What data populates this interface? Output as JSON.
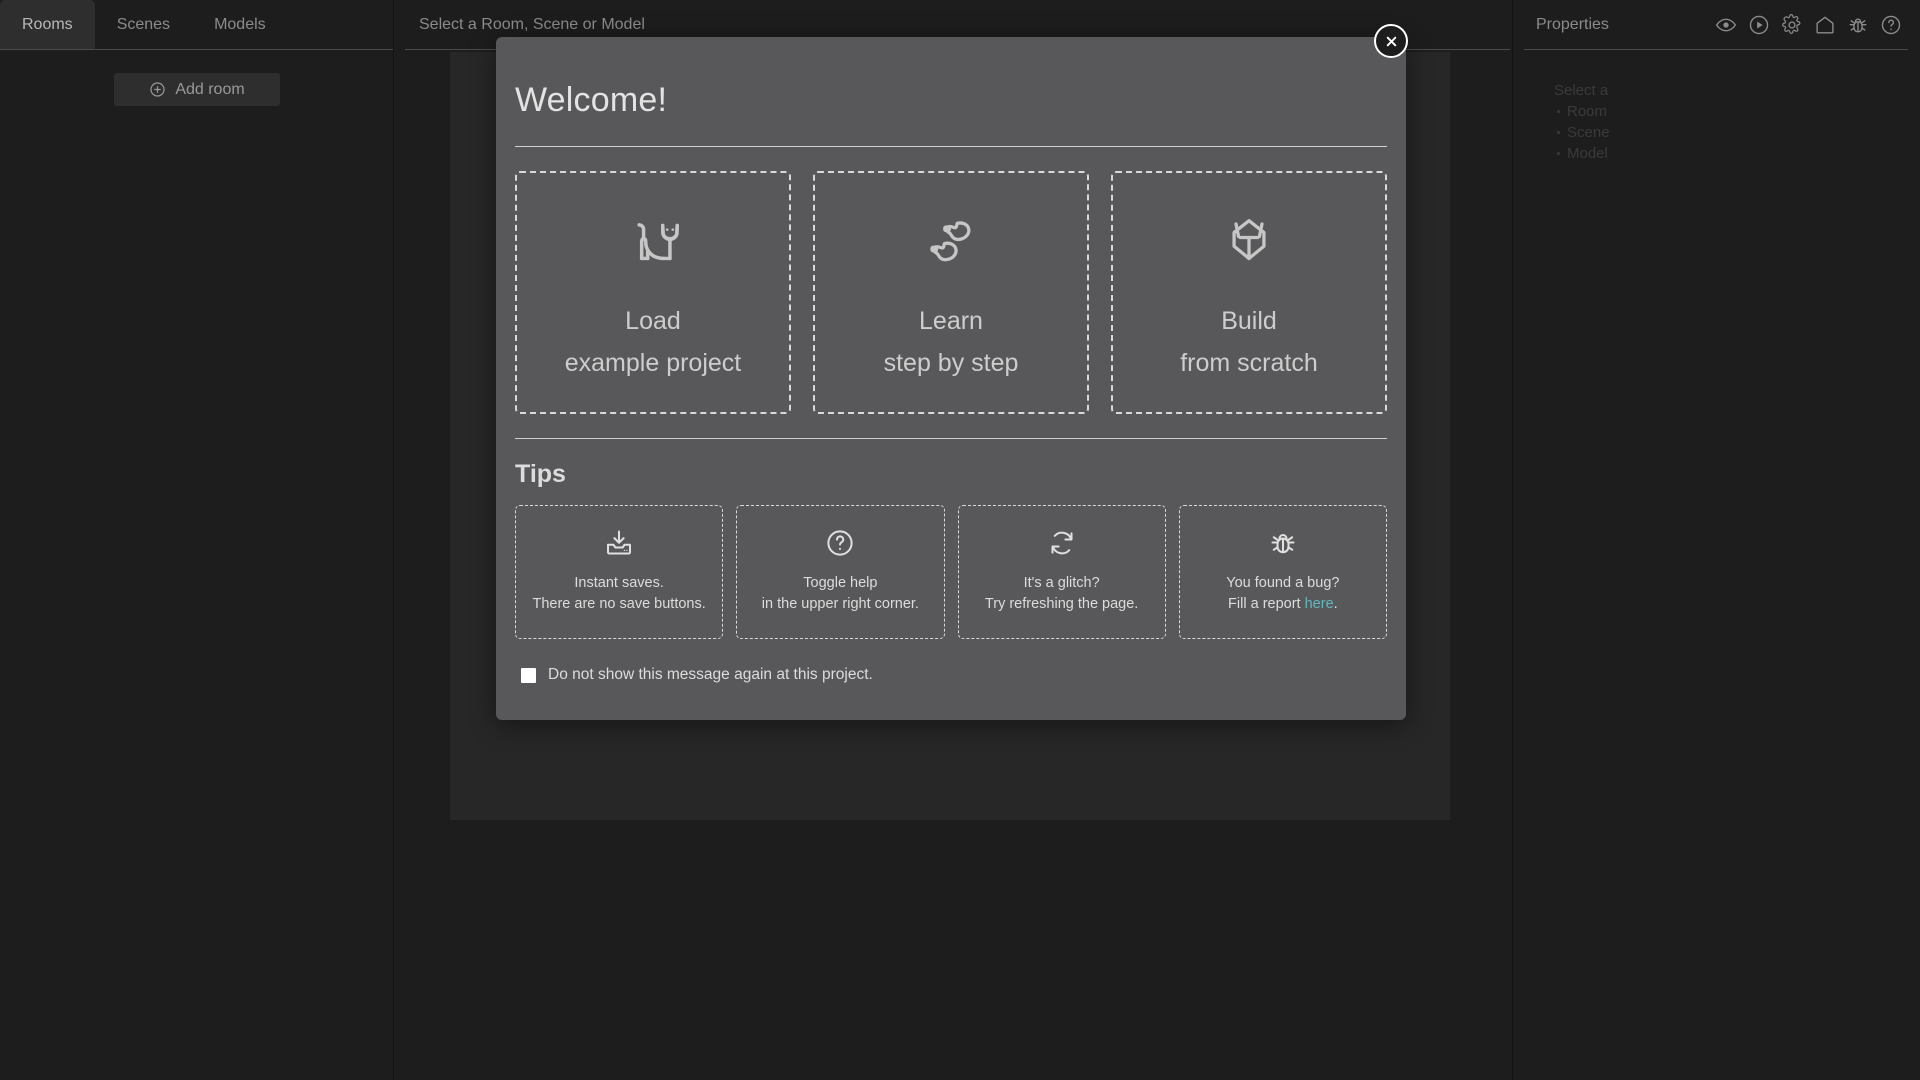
{
  "sidebar": {
    "tabs": [
      {
        "label": "Rooms",
        "active": true
      },
      {
        "label": "Scenes",
        "active": false
      },
      {
        "label": "Models",
        "active": false
      }
    ],
    "add_room_label": "Add room",
    "add_room_icon": "plus-circle-icon"
  },
  "center": {
    "title": "Select a Room, Scene or Model"
  },
  "right": {
    "title": "Properties",
    "icons": [
      {
        "name": "eye-icon"
      },
      {
        "name": "play-circle-icon"
      },
      {
        "name": "gear-icon"
      },
      {
        "name": "home-icon"
      },
      {
        "name": "bug-icon"
      },
      {
        "name": "help-circle-icon"
      }
    ],
    "empty_state": {
      "heading": "Select a",
      "items": [
        "Room",
        "Scene",
        "Model"
      ]
    }
  },
  "modal": {
    "title": "Welcome!",
    "close_label": "×",
    "close_icon": "close-icon",
    "options": [
      {
        "icon": "cat-icon",
        "line1": "Load",
        "line2": "example project"
      },
      {
        "icon": "footprints-icon",
        "line1": "Learn",
        "line2": "step by step"
      },
      {
        "icon": "knight-helmet-icon",
        "line1": "Build",
        "line2": "from scratch"
      }
    ],
    "tips_heading": "Tips",
    "tips": [
      {
        "icon": "save-download-icon",
        "line1": "Instant saves.",
        "line2": "There are no save buttons."
      },
      {
        "icon": "question-circle-icon",
        "line1": "Toggle help",
        "line2": "in the upper right corner."
      },
      {
        "icon": "refresh-icon",
        "line1": "It's a glitch?",
        "line2": "Try refreshing the page."
      },
      {
        "icon": "bug-icon",
        "line1": "You found a bug?",
        "line2_pre": "Fill a report ",
        "line2_link": "here",
        "line2_post": "."
      }
    ],
    "dont_show_label": "Do not show this message again at this project.",
    "dont_show_checked": false
  },
  "colors": {
    "app_background": "#1d1d1d",
    "canvas_background": "#272727",
    "modal_background": "#58585a",
    "link_accent": "#62b8bd",
    "muted_text": "#8b8b8b",
    "modal_text": "#dcdcdc"
  }
}
